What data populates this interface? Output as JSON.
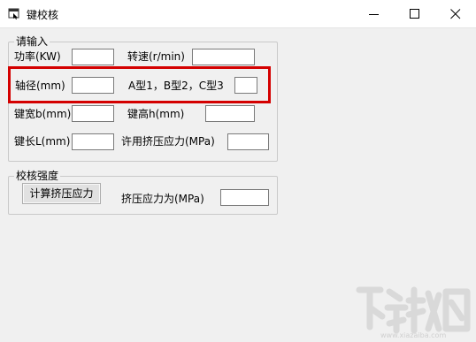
{
  "window": {
    "title": "键校核"
  },
  "input_group": {
    "legend": "请输入",
    "power_label": "功率(KW)",
    "speed_label": "转速(r/min)",
    "shaft_dia_label": "轴径(mm)",
    "type_label": "A型1，B型2，C型3",
    "key_width_label": "键宽b(mm)",
    "key_height_label": "键高h(mm)",
    "key_length_label": "键长L(mm)",
    "allow_stress_label": "许用挤压应力(MPa)",
    "fields": {
      "power": "",
      "speed": "",
      "shaft_dia": "",
      "type": "",
      "key_width": "",
      "key_height": "",
      "key_length": "",
      "allow_stress": ""
    }
  },
  "check_group": {
    "legend": "校核强度",
    "calc_button": "计算挤压应力",
    "result_label": "挤压应力为(MPa)",
    "result_value": ""
  },
  "colors": {
    "highlight": "#d40000"
  },
  "icons": {
    "app": "app-window-icon",
    "minimize": "minimize-icon",
    "maximize": "maximize-icon",
    "close": "close-icon",
    "watermark": "watermark-logo"
  }
}
